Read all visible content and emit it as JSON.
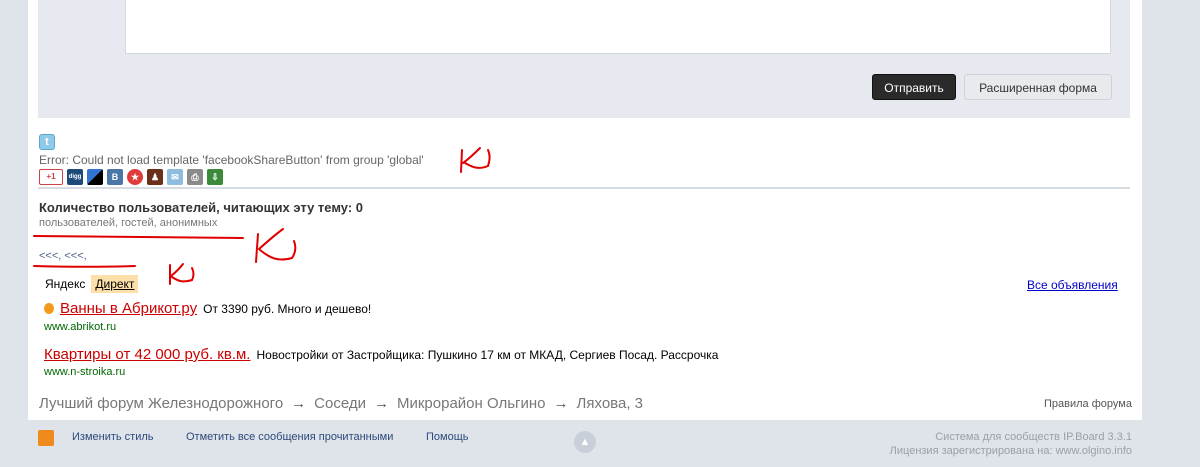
{
  "reply": {
    "submit_label": "Отправить",
    "advanced_label": "Расширенная форма"
  },
  "share": {
    "error_text": "Error: Could not load template 'facebookShareButton' from group 'global'",
    "icons": [
      "twitter-icon",
      "gplus-icon",
      "digg-icon",
      "delicious-icon",
      "vkontakte-icon",
      "star-icon",
      "moikrug-icon",
      "email-icon",
      "print-icon",
      "download-icon"
    ],
    "gplus_text": "+1",
    "vk_text": "B",
    "twitter_text": "t",
    "digg_text": "digg"
  },
  "readers": {
    "title": "Количество пользователей, читающих эту тему: 0",
    "subtitle": "пользователей, гостей, анонимных"
  },
  "nav": {
    "links": "<<<,  <<<,"
  },
  "ads": {
    "yandex": "Яндекс",
    "direct": "Директ",
    "all_ads": "Все объявления",
    "items": [
      {
        "title": "Ванны в Абрикот.ру",
        "desc": "От 3390 руб. Много и дешево!",
        "domain": "www.abrikot.ru"
      },
      {
        "title": "Квартиры от 42 000 руб. кв.м.",
        "desc": "Новостройки от Застройщика: Пушкино 17 км от МКАД, Сергиев Посад. Рассрочка",
        "domain": "www.n-stroika.ru"
      }
    ]
  },
  "breadcrumb": {
    "items": [
      "Лучший форум Железнодорожного",
      "Соседи",
      "Микрорайон Ольгино",
      "Ляхова, 3"
    ],
    "arrow": "→",
    "rules": "Правила форума"
  },
  "footer": {
    "change_style": "Изменить стиль",
    "mark_read": "Отметить все сообщения прочитанными",
    "help": "Помощь",
    "powered": "Система для сообществ IP.Board 3.3.1",
    "license": "Лицензия зарегистрирована на: www.olgino.info"
  },
  "colors": {
    "accent_red": "#cc0000",
    "handwriting": "#e00000",
    "link_blue": "#0000cc",
    "footer_link": "#2c4a7a"
  }
}
